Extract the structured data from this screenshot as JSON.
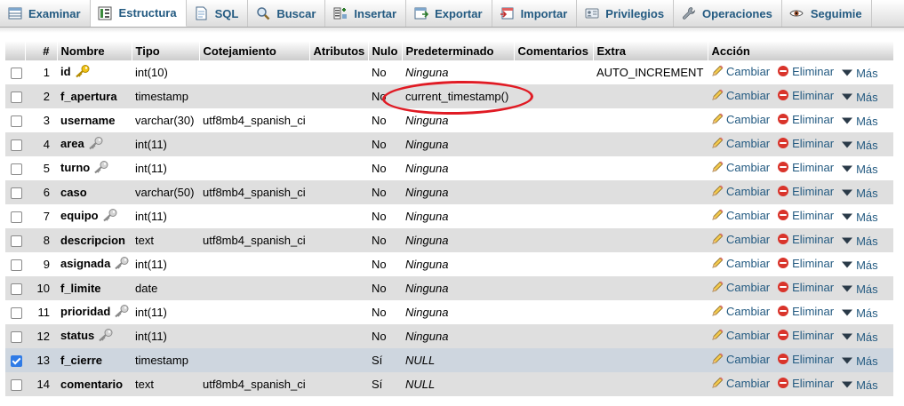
{
  "tabs": [
    {
      "label": "Examinar",
      "icon": "table-browse-icon",
      "active": false
    },
    {
      "label": "Estructura",
      "icon": "structure-icon",
      "active": true
    },
    {
      "label": "SQL",
      "icon": "sql-icon",
      "active": false
    },
    {
      "label": "Buscar",
      "icon": "search-icon",
      "active": false
    },
    {
      "label": "Insertar",
      "icon": "insert-icon",
      "active": false
    },
    {
      "label": "Exportar",
      "icon": "export-icon",
      "active": false
    },
    {
      "label": "Importar",
      "icon": "import-icon",
      "active": false
    },
    {
      "label": "Privilegios",
      "icon": "privileges-icon",
      "active": false
    },
    {
      "label": "Operaciones",
      "icon": "operations-icon",
      "active": false
    },
    {
      "label": "Seguimie",
      "icon": "tracking-icon",
      "active": false
    }
  ],
  "table": {
    "headers": {
      "num": "#",
      "name": "Nombre",
      "type": "Tipo",
      "collation": "Cotejamiento",
      "attributes": "Atributos",
      "null": "Nulo",
      "default": "Predeterminado",
      "comments": "Comentarios",
      "extra": "Extra",
      "action": "Acción"
    },
    "actions": {
      "change": "Cambiar",
      "drop": "Eliminar",
      "more": "Más"
    },
    "rows": [
      {
        "num": "1",
        "name": "id",
        "key": "primary",
        "type": "int(10)",
        "collation": "",
        "attributes": "",
        "null": "No",
        "default": "Ninguna",
        "comments": "",
        "extra": "AUTO_INCREMENT",
        "checked": false
      },
      {
        "num": "2",
        "name": "f_apertura",
        "key": "",
        "type": "timestamp",
        "collation": "",
        "attributes": "",
        "null": "No",
        "default": "current_timestamp()",
        "comments": "",
        "extra": "",
        "checked": false
      },
      {
        "num": "3",
        "name": "username",
        "key": "",
        "type": "varchar(30)",
        "collation": "utf8mb4_spanish_ci",
        "attributes": "",
        "null": "No",
        "default": "Ninguna",
        "comments": "",
        "extra": "",
        "checked": false
      },
      {
        "num": "4",
        "name": "area",
        "key": "index",
        "type": "int(11)",
        "collation": "",
        "attributes": "",
        "null": "No",
        "default": "Ninguna",
        "comments": "",
        "extra": "",
        "checked": false
      },
      {
        "num": "5",
        "name": "turno",
        "key": "index",
        "type": "int(11)",
        "collation": "",
        "attributes": "",
        "null": "No",
        "default": "Ninguna",
        "comments": "",
        "extra": "",
        "checked": false
      },
      {
        "num": "6",
        "name": "caso",
        "key": "",
        "type": "varchar(50)",
        "collation": "utf8mb4_spanish_ci",
        "attributes": "",
        "null": "No",
        "default": "Ninguna",
        "comments": "",
        "extra": "",
        "checked": false
      },
      {
        "num": "7",
        "name": "equipo",
        "key": "index",
        "type": "int(11)",
        "collation": "",
        "attributes": "",
        "null": "No",
        "default": "Ninguna",
        "comments": "",
        "extra": "",
        "checked": false
      },
      {
        "num": "8",
        "name": "descripcion",
        "key": "",
        "type": "text",
        "collation": "utf8mb4_spanish_ci",
        "attributes": "",
        "null": "No",
        "default": "Ninguna",
        "comments": "",
        "extra": "",
        "checked": false
      },
      {
        "num": "9",
        "name": "asignada",
        "key": "index",
        "type": "int(11)",
        "collation": "",
        "attributes": "",
        "null": "No",
        "default": "Ninguna",
        "comments": "",
        "extra": "",
        "checked": false
      },
      {
        "num": "10",
        "name": "f_limite",
        "key": "",
        "type": "date",
        "collation": "",
        "attributes": "",
        "null": "No",
        "default": "Ninguna",
        "comments": "",
        "extra": "",
        "checked": false
      },
      {
        "num": "11",
        "name": "prioridad",
        "key": "index",
        "type": "int(11)",
        "collation": "",
        "attributes": "",
        "null": "No",
        "default": "Ninguna",
        "comments": "",
        "extra": "",
        "checked": false
      },
      {
        "num": "12",
        "name": "status",
        "key": "index",
        "type": "int(11)",
        "collation": "",
        "attributes": "",
        "null": "No",
        "default": "Ninguna",
        "comments": "",
        "extra": "",
        "checked": false
      },
      {
        "num": "13",
        "name": "f_cierre",
        "key": "",
        "type": "timestamp",
        "collation": "",
        "attributes": "",
        "null": "Sí",
        "default": "NULL",
        "comments": "",
        "extra": "",
        "checked": true
      },
      {
        "num": "14",
        "name": "comentario",
        "key": "",
        "type": "text",
        "collation": "utf8mb4_spanish_ci",
        "attributes": "",
        "null": "Sí",
        "default": "NULL",
        "comments": "",
        "extra": "",
        "checked": false
      }
    ]
  },
  "colors": {
    "link": "#235a81",
    "annotation": "#e01b24",
    "key_gold": "#e8b400",
    "drop_red": "#d9342b"
  }
}
